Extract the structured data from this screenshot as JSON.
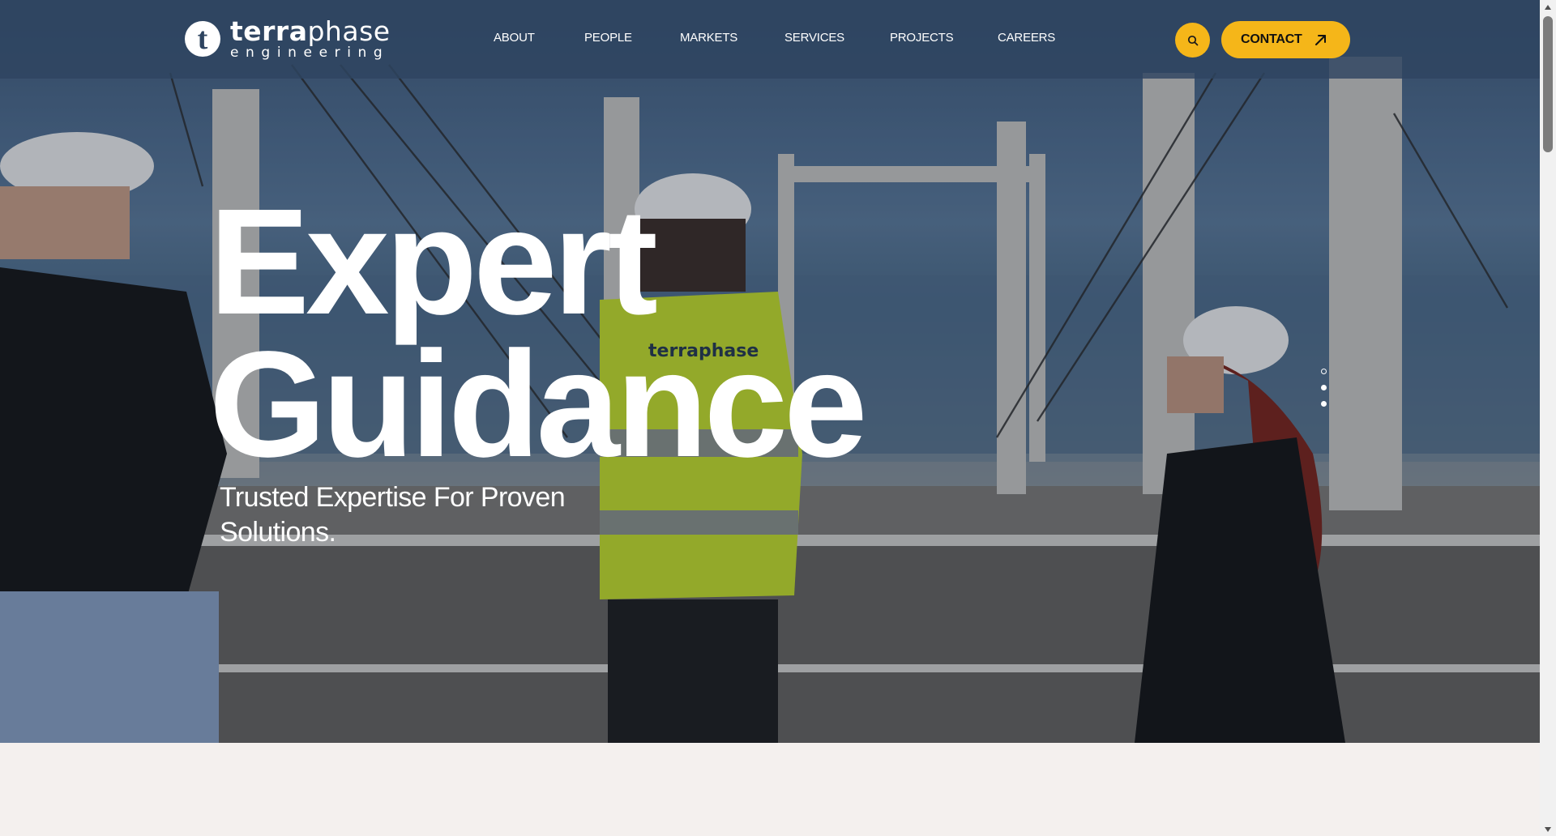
{
  "brand": {
    "logo_mark": "t",
    "name_bold": "terra",
    "name_light": "phase",
    "tagline": "engineering",
    "accent_color": "#f5b619",
    "header_color": "#2e4460"
  },
  "nav": {
    "items": [
      {
        "label": "ABOUT"
      },
      {
        "label": "PEOPLE"
      },
      {
        "label": "MARKETS"
      },
      {
        "label": "SERVICES"
      },
      {
        "label": "PROJECTS"
      },
      {
        "label": "CAREERS"
      }
    ],
    "search_icon": "search-icon",
    "contact_label": "CONTACT",
    "contact_icon": "arrow-up-right-icon"
  },
  "hero": {
    "headline_line1": "Expert",
    "headline_line2": "Guidance",
    "subheading": "Trusted Expertise For Proven Solutions.",
    "slides": {
      "count": 3,
      "active": 1
    },
    "vest_logo": "terraphase"
  },
  "scrollbar": {
    "up_icon": "scroll-up-arrow-icon",
    "down_icon": "scroll-down-arrow-icon"
  }
}
